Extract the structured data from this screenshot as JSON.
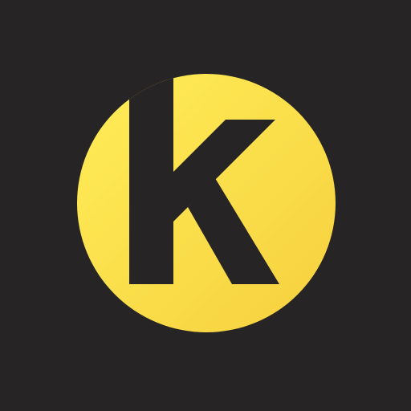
{
  "app_icon": {
    "name": "k-logo-icon",
    "letter": "K",
    "colors": {
      "background": "#262424",
      "circle_light": "#FFEE58",
      "circle_dark": "#F6CF3E",
      "letter": "#262424"
    }
  }
}
